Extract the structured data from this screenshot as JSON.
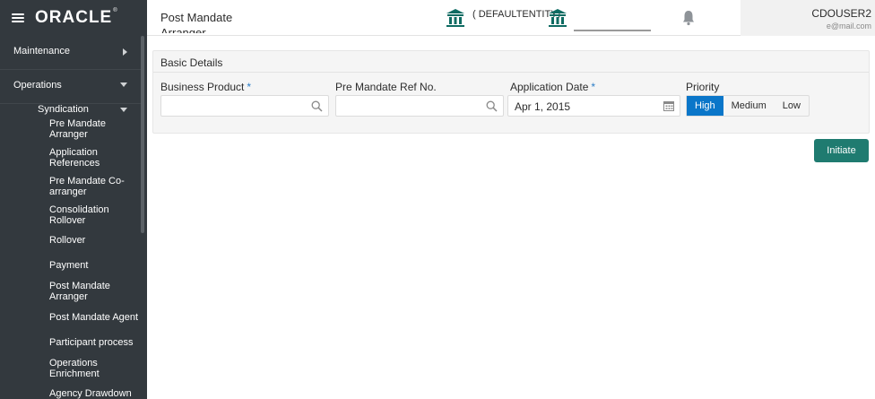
{
  "header": {
    "brand": "ORACLE",
    "page_title": "Post Mandate Arranger",
    "entity": "( DEFAULTENTITY)",
    "user_name": "CDOUSER2",
    "user_email": "e@mail.com"
  },
  "sidebar": {
    "maintenance": "Maintenance",
    "operations": "Operations",
    "syndication": "Syndication",
    "items": [
      "Pre Mandate Arranger",
      "Application References",
      "Pre Mandate Co-arranger",
      "Consolidation Rollover",
      "Rollover",
      "Payment",
      "Post Mandate Arranger",
      "Post Mandate Agent",
      "Participant process",
      "Operations Enrichment",
      "Agency Drawdown"
    ]
  },
  "form": {
    "section_title": "Basic Details",
    "business_product_label": "Business Product",
    "business_product_value": "",
    "pre_mandate_ref_label": "Pre Mandate Ref No.",
    "pre_mandate_ref_value": "",
    "application_date_label": "Application Date",
    "application_date_value": "Apr 1, 2015",
    "required_mark": "*",
    "priority_label": "Priority",
    "priority_options": [
      "High",
      "Medium",
      "Low"
    ],
    "priority_selected": "High"
  },
  "actions": {
    "initiate": "Initiate"
  },
  "colors": {
    "sidebar_bg": "#33393e",
    "accent_blue": "#0a76c9",
    "initiate_green": "#1f7b70",
    "bank_icon_green": "#0e6b62"
  }
}
